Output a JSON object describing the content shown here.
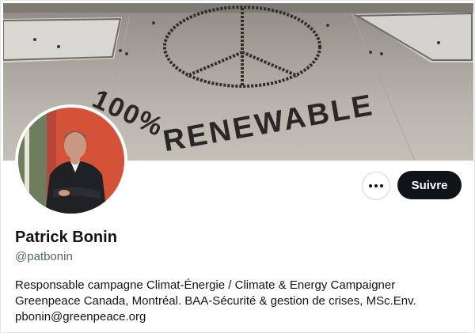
{
  "profile": {
    "name": "Patrick Bonin",
    "handle": "@patbonin",
    "bio_lines": [
      "Responsable campagne Climat-Énergie / Climate & Energy Campaigner",
      "Greenpeace Canada, Montréal. BAA-Sécurité & gestion de crises, MSc.Env.",
      "pbonin@greenpeace.org"
    ]
  },
  "actions": {
    "more_icon": "more-horizontal-icon",
    "follow_label": "Suivre"
  },
  "banner": {
    "text": "100% RENEWABLE",
    "description_icon": "peace-sign"
  },
  "colors": {
    "follow_button_bg": "#0f1419",
    "handle_text": "#536471"
  }
}
